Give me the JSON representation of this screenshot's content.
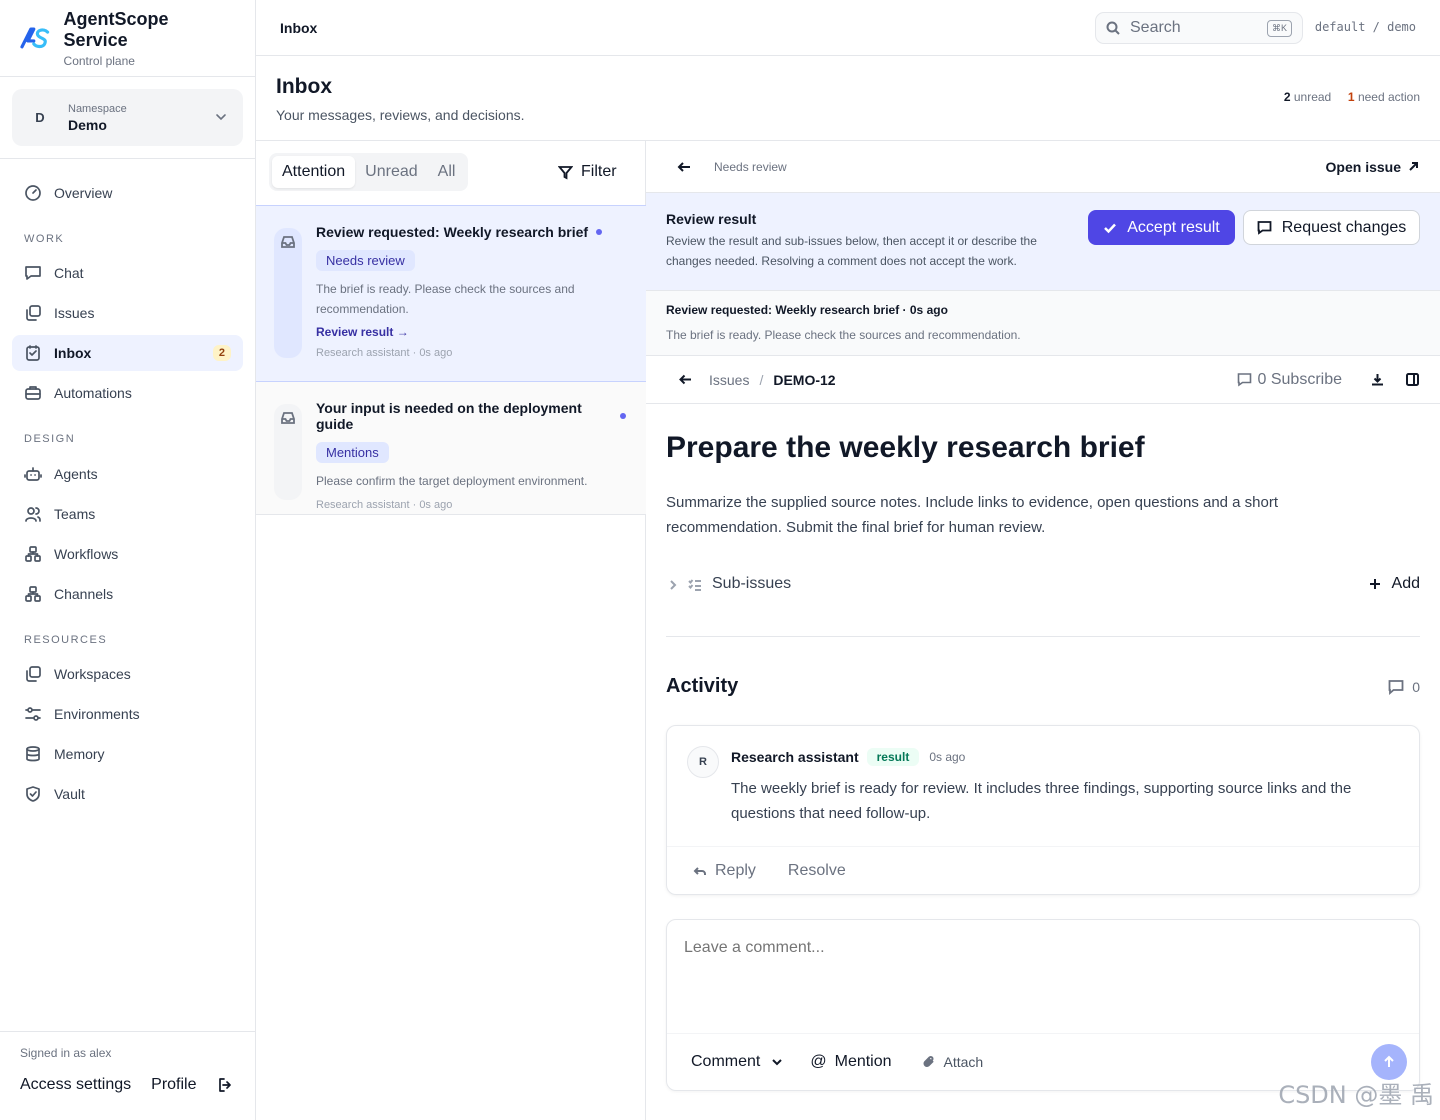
{
  "brand": {
    "name": "AgentScope Service",
    "subtitle": "Control plane",
    "logo_text": "AS"
  },
  "namespace": {
    "avatar": "D",
    "label": "Namespace",
    "value": "Demo"
  },
  "nav": {
    "overview": "Overview",
    "sections": {
      "work": "WORK",
      "design": "DESIGN",
      "resources": "RESOURCES"
    },
    "work": [
      {
        "label": "Chat",
        "icon": "chat-icon"
      },
      {
        "label": "Issues",
        "icon": "issues-icon"
      },
      {
        "label": "Inbox",
        "icon": "inbox-icon",
        "badge": "2",
        "active": true
      },
      {
        "label": "Automations",
        "icon": "automations-icon"
      }
    ],
    "design": [
      {
        "label": "Agents",
        "icon": "robot-icon"
      },
      {
        "label": "Teams",
        "icon": "users-icon"
      },
      {
        "label": "Workflows",
        "icon": "workflow-icon"
      },
      {
        "label": "Channels",
        "icon": "channels-icon"
      }
    ],
    "resources": [
      {
        "label": "Workspaces",
        "icon": "workspaces-icon"
      },
      {
        "label": "Environments",
        "icon": "sliders-icon"
      },
      {
        "label": "Memory",
        "icon": "database-icon"
      },
      {
        "label": "Vault",
        "icon": "shield-icon"
      }
    ]
  },
  "footer": {
    "signed_in": "Signed in as alex",
    "access_settings": "Access settings",
    "profile": "Profile"
  },
  "topbar": {
    "breadcrumb": "Inbox",
    "search_placeholder": "Search",
    "search_kbd": "⌘K",
    "context": "default / demo"
  },
  "page": {
    "title": "Inbox",
    "subtitle": "Your messages, reviews, and decisions.",
    "unread_count": "2",
    "unread_label": "unread",
    "action_count": "1",
    "action_label": "need action"
  },
  "list": {
    "tabs": [
      "Attention",
      "Unread",
      "All"
    ],
    "active_tab": "Attention",
    "filter": "Filter",
    "messages": [
      {
        "title": "Review requested: Weekly research brief",
        "chip": "Needs review",
        "body": "The brief is ready. Please check the sources and recommendation.",
        "link": "Review result →",
        "meta": "Research assistant · 0s ago"
      },
      {
        "title": "Your input is needed on the deployment guide",
        "chip": "Mentions",
        "body": "Please confirm the target deployment environment.",
        "meta": "Research assistant · 0s ago"
      }
    ]
  },
  "detail": {
    "status": "Needs review",
    "open_issue": "Open issue",
    "review": {
      "title": "Review result",
      "text": "Review the result and sub-issues below, then accept it or describe the changes needed. Resolving a comment does not accept the work.",
      "accept": "Accept result",
      "request": "Request changes"
    },
    "preview": {
      "title": "Review requested: Weekly research brief · 0s ago",
      "text": "The brief is ready. Please check the sources and recommendation."
    },
    "issue_bar": {
      "issues": "Issues",
      "separator": "/",
      "id": "DEMO-12",
      "subscribe": "0 Subscribe"
    },
    "issue": {
      "title": "Prepare the weekly research brief",
      "description": "Summarize the supplied source notes. Include links to evidence, open questions and a short recommendation. Submit the final brief for human review.",
      "subissues_label": "Sub-issues",
      "add_label": "Add"
    },
    "activity": {
      "title": "Activity",
      "count": "0",
      "comment": {
        "avatar": "R",
        "author": "Research assistant",
        "tag": "result",
        "time": "0s ago",
        "text": "The weekly brief is ready for review. It includes three findings, supporting source links and the questions that need follow-up.",
        "reply": "Reply",
        "resolve": "Resolve"
      }
    },
    "composer": {
      "placeholder": "Leave a comment...",
      "mode": "Comment",
      "mention": "Mention",
      "attach": "Attach"
    }
  },
  "watermark": "CSDN @墨 禹"
}
